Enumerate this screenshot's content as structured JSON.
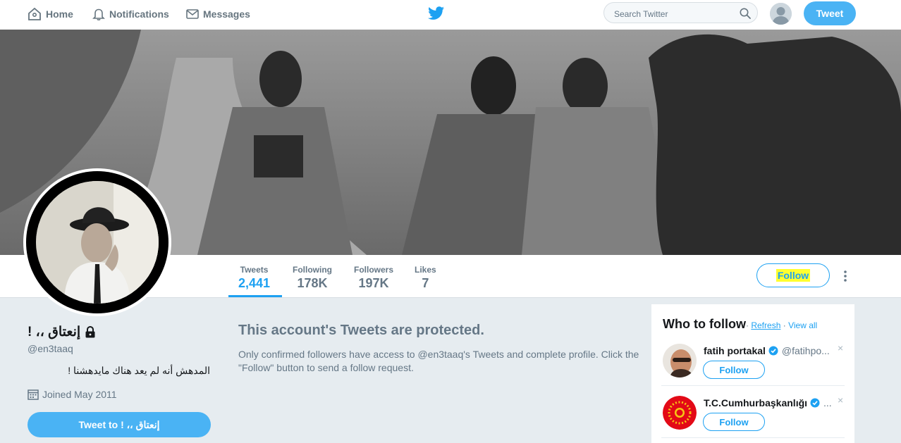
{
  "topnav": {
    "home": "Home",
    "notifications": "Notifications",
    "messages": "Messages",
    "search_placeholder": "Search Twitter",
    "tweet_button": "Tweet"
  },
  "stats": [
    {
      "label": "Tweets",
      "value": "2,441"
    },
    {
      "label": "Following",
      "value": "178K"
    },
    {
      "label": "Followers",
      "value": "197K"
    },
    {
      "label": "Likes",
      "value": "7"
    }
  ],
  "profile": {
    "name": "! ،، إنعتاق",
    "handle": "@en3taaq",
    "bio": "المدهش أنه لم يعد هناك مايدهشنا !",
    "joined": "Joined May 2011",
    "follow_label": "Follow",
    "tweet_to_label": "Tweet to ! ،، إنعتاق"
  },
  "protected": {
    "title": "This account's Tweets are protected.",
    "text": "Only confirmed followers have access to @en3taaq's Tweets and complete profile. Click the \"Follow\" button to send a follow request."
  },
  "who_to_follow": {
    "title": "Who to follow",
    "dot": "·",
    "refresh": "Refresh",
    "view_all": "View all",
    "close": "×",
    "users": [
      {
        "name": "fatih portakal",
        "handle": "@fatihpo...",
        "follow": "Follow"
      },
      {
        "name": "T.C.Cumhurbaşkanlığı",
        "handle": "...",
        "follow": "Follow"
      }
    ]
  },
  "colors": {
    "accent": "#1da1f2",
    "button_fill": "#4ab3f4",
    "highlight": "#ffff2f",
    "background": "#e6ecf0"
  }
}
